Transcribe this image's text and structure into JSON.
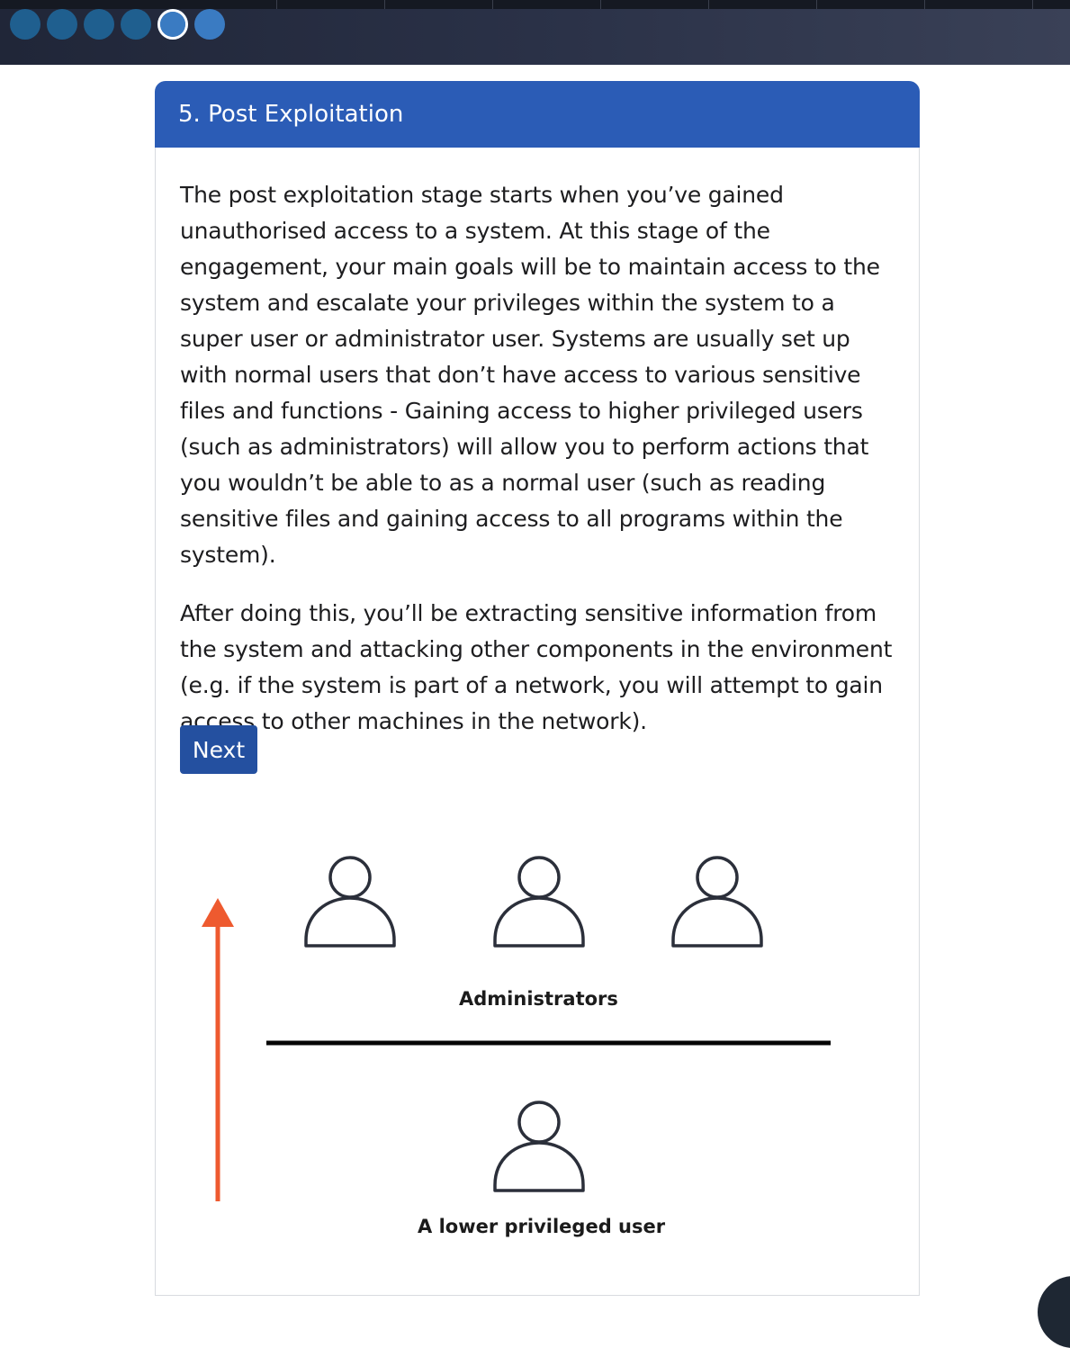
{
  "progress": {
    "steps_total": 6,
    "current_step": 5
  },
  "card": {
    "title": "5. Post Exploitation",
    "paragraphs": [
      "The post exploitation stage starts when you’ve gained unauthorised access to a system. At this stage of the engagement, your main goals will be to maintain access to the system and escalate your privileges within the system to a super user or administrator user. Systems are usually set up with normal users that don’t have access to various sensitive files and functions - Gaining access to higher privileged users (such as administrators) will allow you to perform actions that you wouldn’t be able to as a normal user (such as reading sensitive files and gaining access to all programs within the system).",
      "After doing this, you’ll be extracting sensitive information from the system and attacking other components in the environment (e.g. if the system is part of a network, you will attempt to gain access to other machines in the network)."
    ],
    "next_label": "Next"
  },
  "diagram": {
    "upper_group_label": "Administrators",
    "lower_group_label": "A lower privileged user",
    "arrow_color": "#ee5a2f",
    "icon": "user-icon"
  },
  "colors": {
    "header_bg": "#2b5cb6",
    "button_bg": "#2450a0",
    "topbar_bg": "#2a3147"
  }
}
